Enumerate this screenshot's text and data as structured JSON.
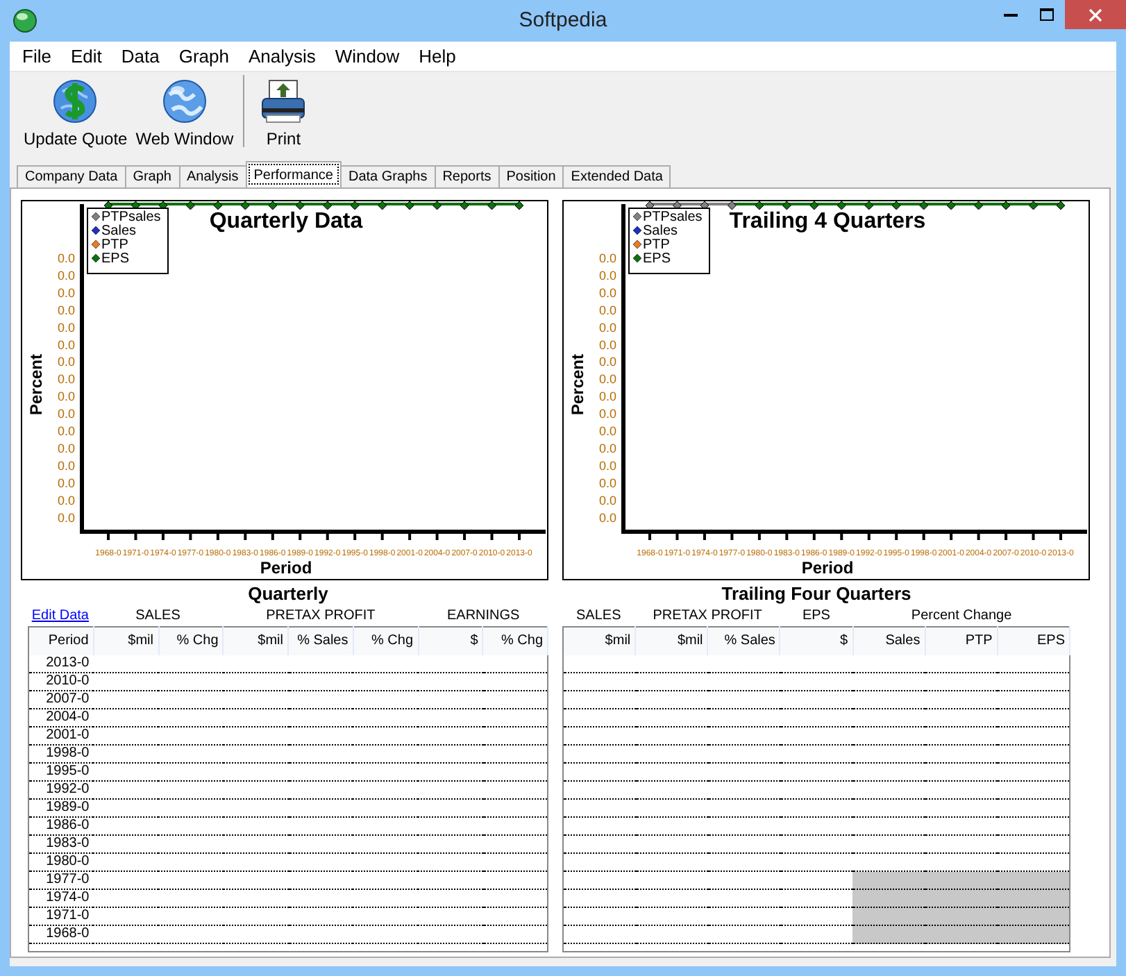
{
  "window": {
    "title": "Softpedia"
  },
  "menu": [
    "File",
    "Edit",
    "Data",
    "Graph",
    "Analysis",
    "Window",
    "Help"
  ],
  "toolbar": [
    {
      "label": "Update Quote",
      "kind": "quote"
    },
    {
      "label": "Web Window",
      "kind": "web"
    },
    {
      "label": "Print",
      "kind": "print"
    }
  ],
  "tabs": [
    {
      "label": "Company Data",
      "selected": false
    },
    {
      "label": "Graph",
      "selected": false
    },
    {
      "label": "Analysis",
      "selected": false
    },
    {
      "label": "Performance",
      "selected": true
    },
    {
      "label": "Data Graphs",
      "selected": false
    },
    {
      "label": "Reports",
      "selected": false
    },
    {
      "label": "Position",
      "selected": false
    },
    {
      "label": "Extended Data",
      "selected": false
    }
  ],
  "charts": [
    {
      "title": "Quarterly Data",
      "y_axis_label": "Percent",
      "x_axis_label": "Period",
      "legend": [
        {
          "label": "PTPsales",
          "color": "#808080"
        },
        {
          "label": "Sales",
          "color": "#1c2fc4"
        },
        {
          "label": "PTP",
          "color": "#f07820"
        },
        {
          "label": "EPS",
          "color": "#107010"
        }
      ],
      "y_tick_labels": [
        "0.0",
        "0.0",
        "0.0",
        "0.0",
        "0.0",
        "0.0",
        "0.0",
        "0.0",
        "0.0",
        "0.0",
        "0.0",
        "0.0",
        "0.0",
        "0.0",
        "0.0",
        "0.0"
      ],
      "x_labels": [
        {
          "label": "1968-0",
          "color": "#107010"
        },
        {
          "label": "1971-0",
          "color": "#107010"
        },
        {
          "label": "1974-0",
          "color": "#107010"
        },
        {
          "label": "1977-0",
          "color": "#107010"
        },
        {
          "label": "1980-0",
          "color": "#107010"
        },
        {
          "label": "1983-0",
          "color": "#107010"
        },
        {
          "label": "1986-0",
          "color": "#107010"
        },
        {
          "label": "1989-0",
          "color": "#107010"
        },
        {
          "label": "1992-0",
          "color": "#107010"
        },
        {
          "label": "1995-0",
          "color": "#107010"
        },
        {
          "label": "1998-0",
          "color": "#107010"
        },
        {
          "label": "2001-0",
          "color": "#107010"
        },
        {
          "label": "2004-0",
          "color": "#107010"
        },
        {
          "label": "2007-0",
          "color": "#107010"
        },
        {
          "label": "2010-0",
          "color": "#107010"
        },
        {
          "label": "2013-0",
          "color": "#107010"
        }
      ]
    },
    {
      "title": "Trailing 4 Quarters",
      "y_axis_label": "Percent",
      "x_axis_label": "Period",
      "legend": [
        {
          "label": "PTPsales",
          "color": "#808080"
        },
        {
          "label": "Sales",
          "color": "#1c2fc4"
        },
        {
          "label": "PTP",
          "color": "#f07820"
        },
        {
          "label": "EPS",
          "color": "#107010"
        }
      ],
      "y_tick_labels": [
        "0.0",
        "0.0",
        "0.0",
        "0.0",
        "0.0",
        "0.0",
        "0.0",
        "0.0",
        "0.0",
        "0.0",
        "0.0",
        "0.0",
        "0.0",
        "0.0",
        "0.0",
        "0.0"
      ],
      "x_labels": [
        {
          "label": "1968-0",
          "color": "#808080"
        },
        {
          "label": "1971-0",
          "color": "#808080"
        },
        {
          "label": "1974-0",
          "color": "#808080"
        },
        {
          "label": "1977-0",
          "color": "#808080"
        },
        {
          "label": "1980-0",
          "color": "#107010"
        },
        {
          "label": "1983-0",
          "color": "#107010"
        },
        {
          "label": "1986-0",
          "color": "#107010"
        },
        {
          "label": "1989-0",
          "color": "#107010"
        },
        {
          "label": "1992-0",
          "color": "#107010"
        },
        {
          "label": "1995-0",
          "color": "#107010"
        },
        {
          "label": "1998-0",
          "color": "#107010"
        },
        {
          "label": "2001-0",
          "color": "#107010"
        },
        {
          "label": "2004-0",
          "color": "#107010"
        },
        {
          "label": "2007-0",
          "color": "#107010"
        },
        {
          "label": "2010-0",
          "color": "#107010"
        },
        {
          "label": "2013-0",
          "color": "#107010"
        }
      ]
    }
  ],
  "tables": [
    {
      "title": "Quarterly",
      "groups": [
        {
          "label": "Edit Data",
          "kind": "link",
          "columns": [
            "Period"
          ]
        },
        {
          "label": "SALES",
          "kind": "heading",
          "columns": [
            "$mil",
            "% Chg"
          ]
        },
        {
          "label": "PRETAX PROFIT",
          "kind": "heading",
          "columns": [
            "$mil",
            "% Sales",
            "% Chg"
          ]
        },
        {
          "label": "EARNINGS",
          "kind": "heading",
          "columns": [
            "$",
            "% Chg"
          ]
        }
      ],
      "rows": [
        {
          "period": "2013-0"
        },
        {
          "period": "2010-0"
        },
        {
          "period": "2007-0"
        },
        {
          "period": "2004-0"
        },
        {
          "period": "2001-0"
        },
        {
          "period": "1998-0"
        },
        {
          "period": "1995-0"
        },
        {
          "period": "1992-0"
        },
        {
          "period": "1989-0"
        },
        {
          "period": "1986-0"
        },
        {
          "period": "1983-0"
        },
        {
          "period": "1980-0"
        },
        {
          "period": "1977-0"
        },
        {
          "period": "1974-0"
        },
        {
          "period": "1971-0"
        },
        {
          "period": "1968-0"
        }
      ]
    },
    {
      "title": "Trailing Four Quarters",
      "groups": [
        {
          "label": "SALES",
          "kind": "heading",
          "columns": [
            "$mil"
          ]
        },
        {
          "label": "PRETAX PROFIT",
          "kind": "heading",
          "columns": [
            "$mil",
            "% Sales"
          ]
        },
        {
          "label": "EPS",
          "kind": "heading",
          "columns": [
            "$"
          ]
        },
        {
          "label": "Percent Change",
          "kind": "heading",
          "columns": [
            "Sales",
            "PTP",
            "EPS"
          ]
        }
      ],
      "rows": [
        {
          "shaded": [
            false,
            false,
            false,
            false,
            false,
            false,
            false
          ]
        },
        {
          "shaded": [
            false,
            false,
            false,
            false,
            false,
            false,
            false
          ]
        },
        {
          "shaded": [
            false,
            false,
            false,
            false,
            false,
            false,
            false
          ]
        },
        {
          "shaded": [
            false,
            false,
            false,
            false,
            false,
            false,
            false
          ]
        },
        {
          "shaded": [
            false,
            false,
            false,
            false,
            false,
            false,
            false
          ]
        },
        {
          "shaded": [
            false,
            false,
            false,
            false,
            false,
            false,
            false
          ]
        },
        {
          "shaded": [
            false,
            false,
            false,
            false,
            false,
            false,
            false
          ]
        },
        {
          "shaded": [
            false,
            false,
            false,
            false,
            false,
            false,
            false
          ]
        },
        {
          "shaded": [
            false,
            false,
            false,
            false,
            false,
            false,
            false
          ]
        },
        {
          "shaded": [
            false,
            false,
            false,
            false,
            false,
            false,
            false
          ]
        },
        {
          "shaded": [
            false,
            false,
            false,
            false,
            false,
            false,
            false
          ]
        },
        {
          "shaded": [
            false,
            false,
            false,
            false,
            false,
            false,
            false
          ]
        },
        {
          "shaded": [
            false,
            false,
            false,
            false,
            true,
            true,
            true
          ]
        },
        {
          "shaded": [
            false,
            false,
            false,
            false,
            true,
            true,
            true
          ]
        },
        {
          "shaded": [
            false,
            false,
            false,
            false,
            true,
            true,
            true
          ]
        },
        {
          "shaded": [
            false,
            false,
            false,
            false,
            true,
            true,
            true
          ]
        }
      ]
    }
  ]
}
